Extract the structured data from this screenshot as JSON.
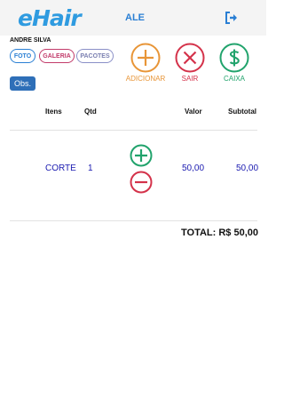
{
  "header": {
    "logo": "eHair",
    "user": "ALE",
    "logout_icon": "logout-icon"
  },
  "client": {
    "name": "ANDRE SILVA",
    "buttons": {
      "foto": "FOTO",
      "galeria": "GALERIA",
      "pacotes": "PACOTES"
    },
    "obs": "Obs."
  },
  "actions": {
    "add": {
      "label": "ADICIONAR",
      "icon": "plus-circle-icon",
      "color": "#e89537"
    },
    "exit": {
      "label": "SAIR",
      "icon": "x-circle-icon",
      "color": "#d4324a"
    },
    "cash": {
      "label": "CAIXA",
      "icon": "dollar-circle-icon",
      "color": "#21a36c"
    }
  },
  "table": {
    "headers": {
      "itens": "Itens",
      "qtd": "Qtd",
      "valor": "Valor",
      "subtotal": "Subtotal"
    },
    "rows": [
      {
        "item": "CORTE",
        "qtd": "1",
        "valor": "50,00",
        "subtotal": "50,00"
      }
    ]
  },
  "total": "TOTAL: R$ 50,00"
}
